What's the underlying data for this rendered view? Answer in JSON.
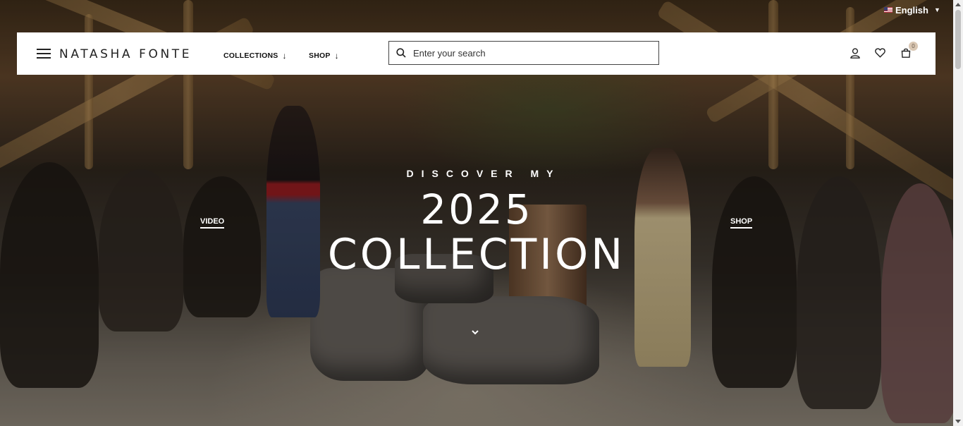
{
  "language": {
    "label": "English",
    "flag_icon": "us-flag-icon"
  },
  "header": {
    "brand": "NATASHA FONTE",
    "nav": [
      {
        "label": "COLLECTIONS",
        "icon": "arrow-down-icon"
      },
      {
        "label": "SHOP",
        "icon": "arrow-down-icon"
      }
    ],
    "search": {
      "placeholder": "Enter your search",
      "value": ""
    },
    "cart_count": "0"
  },
  "hero": {
    "eyebrow": "DISCOVER MY",
    "year": "2025",
    "title": "COLLECTION",
    "left_link": "VIDEO",
    "right_link": "SHOP"
  },
  "colors": {
    "header_bg": "#ffffff",
    "text_dark": "#111111",
    "hero_text": "#ffffff",
    "badge_bg": "#d9c7b3"
  }
}
